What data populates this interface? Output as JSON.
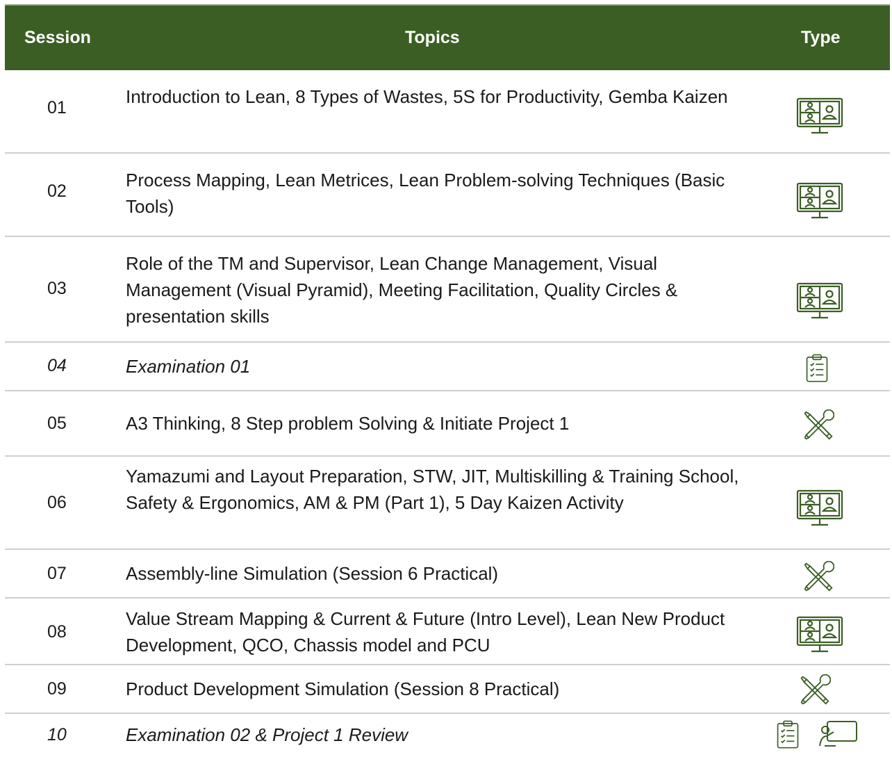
{
  "header": {
    "session": "Session",
    "topics": "Topics",
    "type": "Type"
  },
  "accent_color": "#3b5e24",
  "rows": [
    {
      "session": "01",
      "topic": "Introduction to Lean, 8 Types of Wastes, 5S for Productivity, Gemba Kaizen",
      "type_icons": [
        "virtual-classroom-icon"
      ],
      "italic": false
    },
    {
      "session": "02",
      "topic": "Process Mapping, Lean Metrices, Lean Problem-solving Techniques (Basic Tools)",
      "type_icons": [
        "virtual-classroom-icon"
      ],
      "italic": false
    },
    {
      "session": "03",
      "topic": "Role of the TM and Supervisor, Lean Change Management, Visual Management (Visual Pyramid), Meeting Facilitation, Quality Circles & presentation skills",
      "type_icons": [
        "virtual-classroom-icon"
      ],
      "italic": false
    },
    {
      "session": "04",
      "topic": "Examination 01",
      "type_icons": [
        "clipboard-checklist-icon"
      ],
      "italic": true
    },
    {
      "session": "05",
      "topic": "A3 Thinking,  8 Step problem Solving & Initiate Project 1",
      "type_icons": [
        "tools-icon"
      ],
      "italic": false
    },
    {
      "session": "06",
      "topic": "Yamazumi and Layout Preparation, STW, JIT, Multiskilling & Training School, Safety & Ergonomics, AM & PM (Part 1), 5 Day Kaizen Activity",
      "type_icons": [
        "virtual-classroom-icon"
      ],
      "italic": false
    },
    {
      "session": "07",
      "topic": "Assembly-line Simulation (Session 6 Practical)",
      "type_icons": [
        "tools-icon"
      ],
      "italic": false
    },
    {
      "session": "08",
      "topic": "Value Stream Mapping & Current & Future (Intro Level),  Lean New Product Development, QCO, Chassis model and PCU",
      "type_icons": [
        "virtual-classroom-icon"
      ],
      "italic": false
    },
    {
      "session": "09",
      "topic": "Product Development Simulation (Session 8 Practical)",
      "type_icons": [
        "tools-icon"
      ],
      "italic": false
    },
    {
      "session": "10",
      "topic": "Examination 02 & Project 1 Review",
      "type_icons": [
        "clipboard-checklist-icon",
        "presentation-board-icon"
      ],
      "italic": true
    }
  ]
}
